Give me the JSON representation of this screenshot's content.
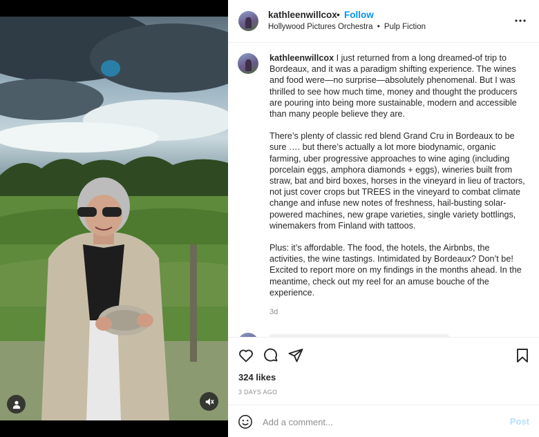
{
  "post": {
    "username": "kathleenwillcox",
    "separator": "•",
    "follow_label": "Follow",
    "audio_artist": "Hollywood Pictures Orchestra",
    "audio_dot": "•",
    "audio_title": "Pulp Fiction"
  },
  "caption": {
    "username": "kathleenwillcox",
    "paragraph_1": "I just returned from a long dreamed-of trip to Bordeaux, and it was a paradigm shifting experience. The wines and food were—no surprise—absolutely phenomenal. But I was thrilled to see how much time, money and thought the producers are pouring into being more sustainable, modern and accessible than many people believe they are.",
    "paragraph_2": "There’s plenty of classic red blend Grand Cru in Bordeaux to be sure …. but there’s actually a lot more biodynamic, organic farming, uber progressive approaches to wine aging (including porcelain eggs, amphora diamonds + eggs), wineries built from straw, bat and bird boxes, horses in the vineyard in lieu of tractors, not just cover crops but TREES in the vineyard to combat climate change and infuse new notes of freshness, hail-busting solar-powered machines, new grape varieties, single variety bottlings, winemakers from Finland with tattoos.",
    "paragraph_3": "Plus: it’s affordable. The food, the hotels, the Airbnbs, the activities, the wine tastings. Intimidated by Bordeaux? Don’t be! Excited to report more on my findings in the months ahead. In the meantime, check out my reel for an amuse bouche of the experience.",
    "age": "3d"
  },
  "stats": {
    "likes": "324 likes",
    "date": "3 DAYS AGO"
  },
  "comment_box": {
    "placeholder": "Add a comment...",
    "post_label": "Post"
  },
  "icons": {
    "more": "more-options-icon",
    "like": "heart-icon",
    "comment": "comment-icon",
    "share": "share-icon",
    "save": "bookmark-icon",
    "emoji": "emoji-icon",
    "tag": "user-tag-icon",
    "mute": "audio-muted-icon"
  },
  "colors": {
    "follow": "#0095f6",
    "post_disabled": "#b2dffc",
    "muted_text": "#8e8e8e"
  }
}
